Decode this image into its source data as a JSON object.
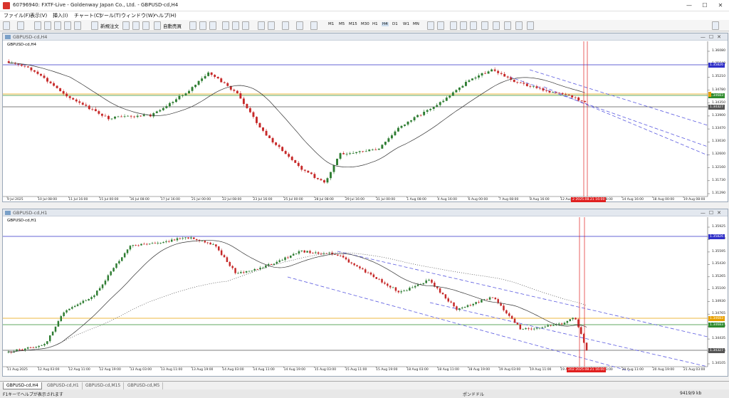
{
  "window": {
    "title": "60796940: FXTF-Live - Goldenway Japan Co., Ltd. - GBPUSD-cd,H4",
    "buttons": [
      "—",
      "☐",
      "✕"
    ]
  },
  "menu": [
    "ファイル(F)",
    "表示(V)",
    "挿入(I)",
    "チャート(C)",
    "ツール(T)",
    "ウィンドウ(W)",
    "ヘルプ(H)"
  ],
  "toolbar": {
    "new_order": "新規注文",
    "auto_trading": "自動売買",
    "timeframes": [
      "M1",
      "M5",
      "M15",
      "M30",
      "H1",
      "H4",
      "D1",
      "W1",
      "MN"
    ],
    "active_timeframe": "H4"
  },
  "chart_h4": {
    "window_title": "GBPUSD-cd,H4",
    "symbol_label": "GBPUSD-cd,H4",
    "y_ticks": [
      "1.36080",
      "1.35640",
      "1.35210",
      "1.34780",
      "1.34350",
      "1.33900",
      "1.33470",
      "1.33030",
      "1.32600",
      "1.32160",
      "1.31730",
      "1.31290"
    ],
    "price_tags": {
      "blue": "1.35826",
      "green": "1.34683",
      "black": "1.34327"
    },
    "x_labels": [
      "9 Jul 2025",
      "10 Jul 08:00",
      "11 Jul 16:00",
      "15 Jul 00:00",
      "16 Jul 08:00",
      "17 Jul 16:00",
      "21 Jul 00:00",
      "22 Jul 08:00",
      "23 Jul 16:00",
      "25 Jul 00:00",
      "28 Jul 08:00",
      "29 Jul 16:00",
      "31 Jul 00:00",
      "1 Aug 08:00",
      "4 Aug 16:00",
      "6 Aug 00:00",
      "7 Aug 08:00",
      "8 Aug 16:00",
      "12 Aug 00:00",
      "13 Aug 08:00",
      "14 Aug 16:00",
      "18 Aug 00:00",
      "19 Aug 08:00"
    ],
    "cursor_time": "2 2025.08.21 16:00"
  },
  "chart_h1": {
    "window_title": "GBPUSD-cd,H1",
    "symbol_label": "GBPUSD-cd,H1",
    "y_ticks": [
      "1.35925",
      "1.35760",
      "1.35595",
      "1.35430",
      "1.35265",
      "1.35100",
      "1.34930",
      "1.34765",
      "1.34600",
      "1.34435",
      "1.34270",
      "1.34105"
    ],
    "price_tags": {
      "blue": "1.35826",
      "orange": "1.34683",
      "green": "1.34683",
      "black": "1.34327"
    },
    "x_labels": [
      "11 Aug 2025",
      "12 Aug 03:00",
      "12 Aug 11:00",
      "12 Aug 19:00",
      "13 Aug 03:00",
      "13 Aug 11:00",
      "13 Aug 19:00",
      "14 Aug 03:00",
      "14 Aug 11:00",
      "14 Aug 19:00",
      "15 Aug 03:00",
      "15 Aug 11:00",
      "15 Aug 19:00",
      "18 Aug 03:00",
      "18 Aug 11:00",
      "18 Aug 19:00",
      "19 Aug 03:00",
      "19 Aug 11:00",
      "19 Aug 19:00",
      "20 Aug 03:00",
      "20 Aug 11:00",
      "20 Aug 19:00",
      "21 Aug 03:00"
    ],
    "cursor_time": "202 2025.08.21 16:00"
  },
  "tabs": [
    "GBPUSD-cd,H4",
    "GBPUSD-cd,H1",
    "GBPUSD-cd,M15",
    "GBPUSD-cd,M5"
  ],
  "active_tab": "GBPUSD-cd,H4",
  "status": {
    "help": "F1キーでヘルプが表示されます",
    "profile": "ポンドドル",
    "traffic": "9419/9 kb"
  },
  "colors": {
    "bull": "#2e7d32",
    "bear": "#c62828",
    "blue_line": "#3030c8",
    "green_line": "#2e8b2e",
    "orange_line": "#e8a000",
    "channel": "#5a5ae0",
    "cursor": "#e02020"
  }
}
